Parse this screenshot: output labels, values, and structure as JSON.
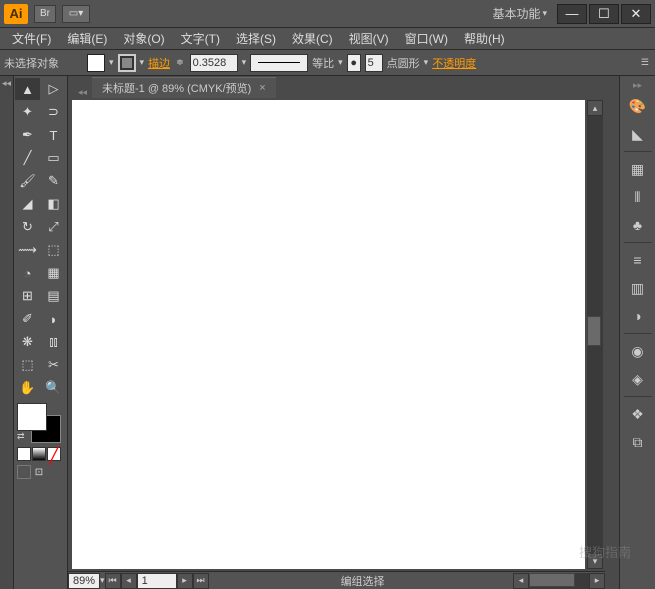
{
  "titlebar": {
    "logo": "Ai",
    "bridge": "Br",
    "workspace": "基本功能"
  },
  "menu": {
    "file": "文件(F)",
    "edit": "编辑(E)",
    "object": "对象(O)",
    "type": "文字(T)",
    "select": "选择(S)",
    "effect": "效果(C)",
    "view": "视图(V)",
    "window": "窗口(W)",
    "help": "帮助(H)"
  },
  "control": {
    "no_selection": "未选择对象",
    "stroke_label": "描边",
    "stroke_weight": "0.3528",
    "stroke_style": "等比",
    "brush_size": "5",
    "brush_type": "点圆形",
    "opacity_label": "不透明度"
  },
  "document": {
    "tab_title": "未标题-1 @ 89% (CMYK/预览)"
  },
  "status": {
    "zoom": "89%",
    "page": "1",
    "mode": "编组选择"
  },
  "watermark": "搜狗指南"
}
